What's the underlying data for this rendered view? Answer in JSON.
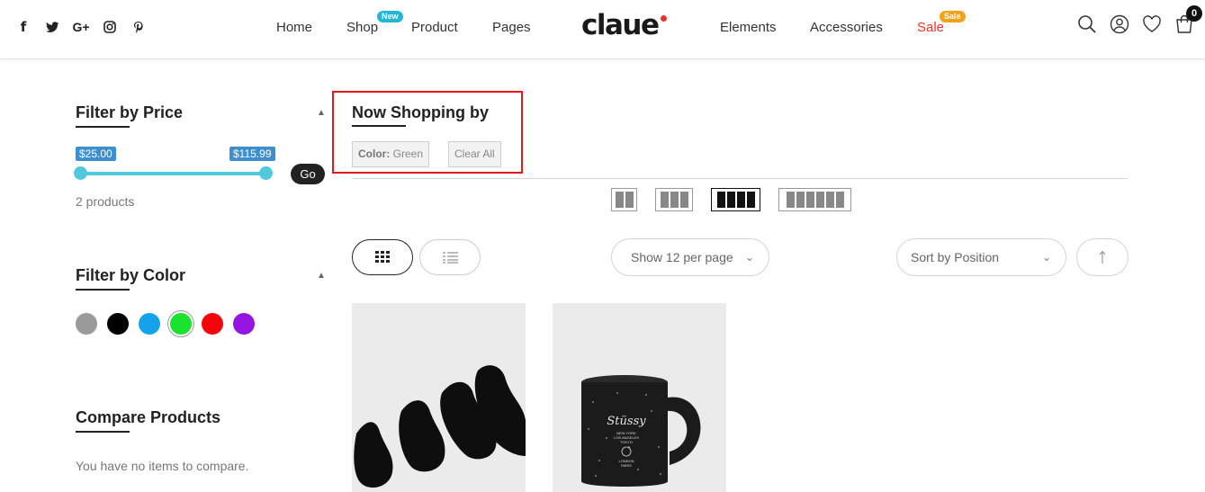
{
  "header": {
    "social_icons": [
      "facebook-icon",
      "twitter-icon",
      "google-plus-icon",
      "instagram-icon",
      "pinterest-icon"
    ],
    "social_glyphs": {
      "facebook": "f",
      "google_plus": "G+"
    },
    "nav": {
      "home": "Home",
      "shop": "Shop",
      "shop_badge": "New",
      "product": "Product",
      "pages": "Pages",
      "elements": "Elements",
      "accessories": "Accessories",
      "sale": "Sale",
      "sale_badge": "Sale"
    },
    "logo": "claue",
    "cart_count": "0",
    "right_icons": [
      "search-icon",
      "user-icon",
      "heart-icon",
      "cart-icon"
    ]
  },
  "sidebar": {
    "price_filter": {
      "title": "Filter by Price",
      "min_label": "$25.00",
      "max_label": "$115.99",
      "go_label": "Go",
      "result_text": "2 products"
    },
    "color_filter": {
      "title": "Filter by Color",
      "swatches": [
        {
          "name": "gray",
          "color": "#9a9a9a"
        },
        {
          "name": "black",
          "color": "#000000"
        },
        {
          "name": "blue",
          "color": "#14a3ea"
        },
        {
          "name": "green",
          "color": "#1ae22f",
          "selected": true
        },
        {
          "name": "red",
          "color": "#f2060c"
        },
        {
          "name": "purple",
          "color": "#9414e0"
        }
      ]
    },
    "compare": {
      "title": "Compare Products",
      "empty_text": "You have no items to compare."
    }
  },
  "now_shopping": {
    "title": "Now Shopping by",
    "active_filter_label": "Color:",
    "active_filter_value": "Green",
    "clear_all": "Clear All"
  },
  "toolbar": {
    "grid_columns": [
      2,
      3,
      4,
      6
    ],
    "grid_active": 4,
    "view_modes": [
      "grid-view-icon",
      "list-view-icon"
    ],
    "per_page": "Show 12 per page",
    "sort_by": "Sort by Position",
    "sort_direction_icon": "arrow-up-icon"
  },
  "products": [
    {
      "image": "black no-show socks"
    },
    {
      "image": "black speckled camp mug",
      "print_lines": [
        "Stüssy",
        "NEW YORK",
        "LOS ANGELES",
        "TOKYO",
        "LONDON",
        "PARIS"
      ]
    }
  ],
  "colors": {
    "accent": "#50c8de",
    "price_tag": "#3f8fce",
    "sale": "#e8332b",
    "highlight_box": "#e51b1b"
  }
}
